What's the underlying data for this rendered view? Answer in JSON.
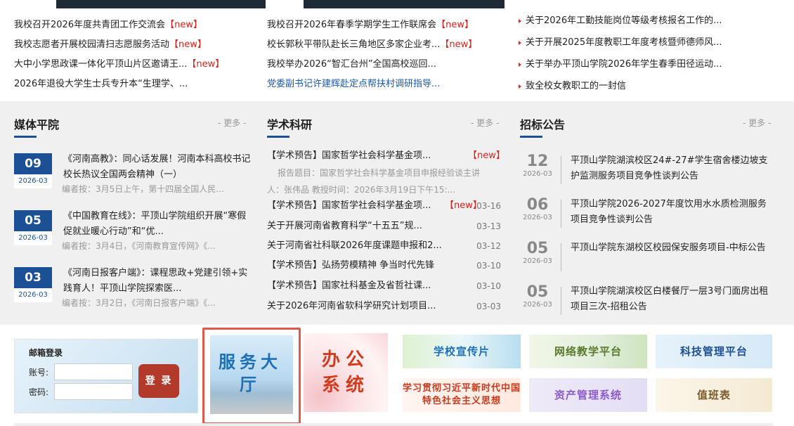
{
  "top_news": {
    "col1": [
      {
        "text": "我校召开2026年度共青团工作交流会",
        "tag": "【new】"
      },
      {
        "text": "我校志愿者开展校园清扫志愿服务活动",
        "tag": "【new】"
      },
      {
        "text": "大中小学思政课一体化平顶山片区邀请王...",
        "tag": "【new】"
      },
      {
        "text": "2026年退役大学生士兵专升本“生理学、...",
        "tag": ""
      }
    ],
    "col2": [
      {
        "text": "我校召开2026年春季学期学生工作联席会",
        "tag": "【new】"
      },
      {
        "text": "校长郭秋平带队赴长三角地区多家企业考...",
        "tag": "【new】"
      },
      {
        "text": "我校举办2026“智汇台州”全国高校巡回...",
        "tag": ""
      },
      {
        "text": "党委副书记许建辉赴定点帮扶村调研指导...",
        "tag": ""
      }
    ],
    "col3": [
      {
        "text": "关于2026年工勤技能岗位等级考核报名工作的..."
      },
      {
        "text": "关于开展2025年度教职工年度考核暨师德师风..."
      },
      {
        "text": "关于举办平顶山学院2026年学生春季田径运动..."
      },
      {
        "text": "致全校女教职工的一封信"
      }
    ]
  },
  "media": {
    "title": "媒体平院",
    "more": "- 更多 -",
    "items": [
      {
        "day": "09",
        "ym": "2026-03",
        "title": "《河南高教》：同心话发展！河南本科高校书记校长热议全国两会精神（一）",
        "summary": "编者按：3月5日上午，第十四届全国人民..."
      },
      {
        "day": "05",
        "ym": "2026-03",
        "title": "《中国教育在线》：平顶山学院组织开展“寒假促就业暖心行动”和“优...",
        "summary": "编者按：3月4日，《河南教育宣传网》《..."
      },
      {
        "day": "03",
        "ym": "2026-03",
        "title": "《河南日报客户端》：课程思政+党建引领+实践育人！平顶山学院探索医...",
        "summary": "编者按：3月2日，《河南日报客户端》《..."
      }
    ]
  },
  "research": {
    "title": "学术科研",
    "more": "- 更多 -",
    "featured": {
      "text": "【学术预告】国家哲学社会科学基金项...",
      "tag": "【new】"
    },
    "featured_summary": "报告题目：国家哲学社会科学基金项目申报经验谈主讲人：张伟品 教授时间：2026年3月19日下午15:...",
    "items": [
      {
        "text": "【学术预告】国家哲学社会科学基金项...",
        "tag": "【new】",
        "date": "03-16"
      },
      {
        "text": "关于开展河南省教育科学“十五五”规...",
        "tag": "",
        "date": "03-13"
      },
      {
        "text": "关于河南省社科联2026年度课题申报和2...",
        "tag": "",
        "date": "03-12"
      },
      {
        "text": "【学术预告】弘扬劳模精神 争当时代先锋",
        "tag": "",
        "date": "03-10"
      },
      {
        "text": "【学术预告】国家社科基金及省哲社课...",
        "tag": "",
        "date": "03-10"
      },
      {
        "text": "关于2026年河南省软科学研究计划项目...",
        "tag": "",
        "date": "03-03"
      }
    ]
  },
  "tender": {
    "title": "招标公告",
    "more": "- 更多 -",
    "items": [
      {
        "day": "12",
        "ym": "2026-03",
        "title": "平顶山学院湖滨校区24#-27#学生宿舍楼边坡支护监测服务项目竞争性谈判公告"
      },
      {
        "day": "06",
        "ym": "2026-03",
        "title": "平顶山学院2026-2027年度饮用水水质检测服务项目竞争性谈判公告"
      },
      {
        "day": "05",
        "ym": "2026-03",
        "title": "平顶山学院东湖校区校园保安服务项目-中标公告"
      },
      {
        "day": "05",
        "ym": "2026-03",
        "title": "平顶山学院湖滨校区白楼餐厅一层3号门面房出租项目三次-招租公告"
      }
    ]
  },
  "mail": {
    "title": "邮箱登录",
    "account_label": "账号:",
    "password_label": "密码:",
    "login": "登 录"
  },
  "quick_links": {
    "service_hall": "服务大厅",
    "office": "办公系统",
    "promo": "学校宣传片",
    "online_teaching": "网络教学平台",
    "science_mgmt": "科技管理平台",
    "thought": "学习贯彻习近平新时代中国特色社会主义思想",
    "asset": "资产管理系统",
    "duty": "值班表"
  }
}
